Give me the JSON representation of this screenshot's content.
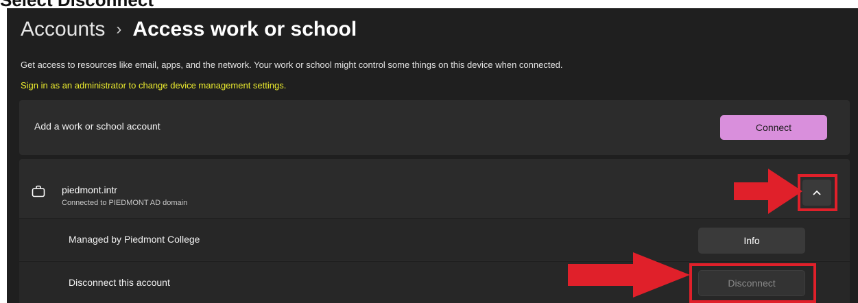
{
  "caption": "Select Disconnect",
  "breadcrumb": {
    "parent": "Accounts",
    "separator": "›",
    "current": "Access work or school"
  },
  "description": "Get access to resources like email, apps, and the network. Your work or school might control some things on this device when connected.",
  "admin_link": "Sign in as an administrator to change device management settings.",
  "add_account": {
    "label": "Add a work or school account",
    "button_label": "Connect"
  },
  "account": {
    "icon": "briefcase-icon",
    "name": "piedmont.intr",
    "subtitle": "Connected to PIEDMONT AD domain",
    "expand_icon": "chevron-up-icon",
    "managed_label": "Managed by Piedmont College",
    "info_button": "Info",
    "disconnect_label": "Disconnect this account",
    "disconnect_button": "Disconnect"
  },
  "colors": {
    "background": "#1f1f1f",
    "card": "#2c2c2c",
    "accent_button": "#d98fdc",
    "link_yellow": "#eded2e",
    "annotation_red": "#e0202a"
  }
}
